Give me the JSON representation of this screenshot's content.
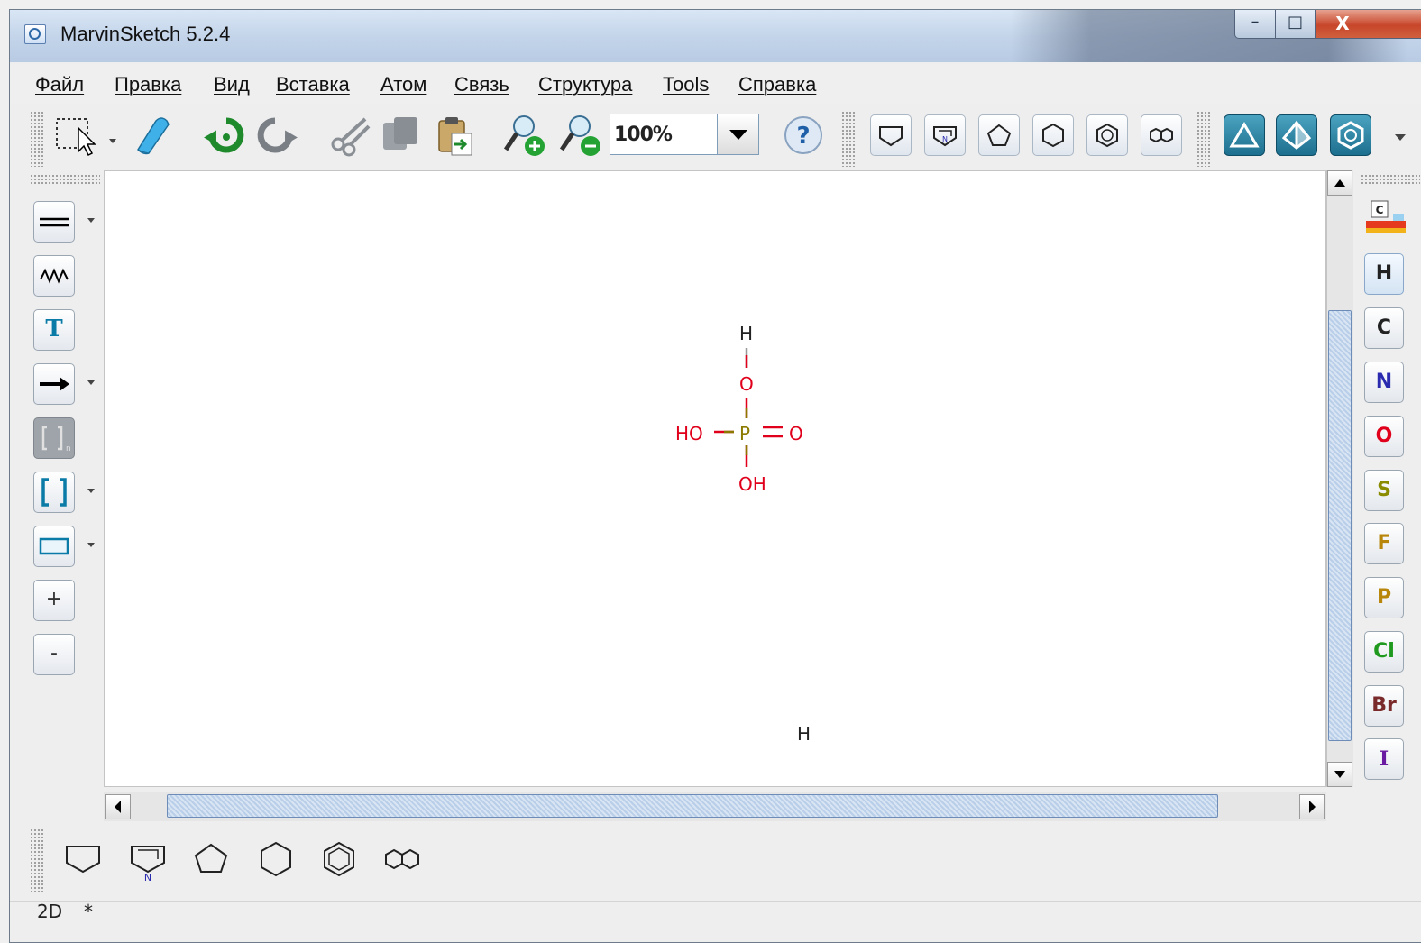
{
  "window": {
    "title": "MarvinSketch 5.2.4",
    "controls": {
      "minimize": "–",
      "maximize": "□",
      "close": "X"
    }
  },
  "menu": {
    "items": [
      "Файл",
      "Правка",
      "Вид",
      "Вставка",
      "Атом",
      "Связь",
      "Структура",
      "Tools",
      "Справка"
    ]
  },
  "toolbar": {
    "zoom_value": "100%",
    "help_label": "?",
    "icons": [
      "selection-icon",
      "eraser-icon",
      "undo-icon",
      "redo-icon",
      "cut-icon",
      "copy-icon",
      "paste-icon",
      "zoom-in-icon",
      "zoom-out-icon",
      "help-icon"
    ],
    "templates": [
      "cyclohexane-chair-template",
      "pyrrolidine-template",
      "cyclopentane-template",
      "cyclohexane-template",
      "benzene-template",
      "naphthalene-template"
    ],
    "view_modes": [
      "2d-triangle-icon",
      "3d-tetrahedron-icon",
      "aromatic-ring-icon"
    ]
  },
  "left_tools": {
    "text_tool": "T",
    "plus": "+",
    "minus": "-",
    "items": [
      "double-bond-icon",
      "chain-icon",
      "text-tool",
      "reaction-arrow-icon",
      "repeating-unit-icon",
      "bracket-icon",
      "rectangle-icon",
      "charge-plus-button",
      "charge-minus-button"
    ]
  },
  "canvas": {
    "atoms": {
      "top_h": "H",
      "top_o": "O",
      "ho": "HO",
      "p": "P",
      "eq_o": "O",
      "oh": "OH",
      "stray_h": "H"
    },
    "colors": {
      "oxygen": "#e0001b",
      "phosphorus": "#8b7a00",
      "hydrogen": "#222222"
    }
  },
  "elements": [
    {
      "symbol": "H",
      "color": "#222222"
    },
    {
      "symbol": "C",
      "color": "#222222"
    },
    {
      "symbol": "N",
      "color": "#2b2bb0"
    },
    {
      "symbol": "O",
      "color": "#e0001b"
    },
    {
      "symbol": "S",
      "color": "#8b8b00"
    },
    {
      "symbol": "F",
      "color": "#b8860b"
    },
    {
      "symbol": "P",
      "color": "#b8860b"
    },
    {
      "symbol": "Cl",
      "color": "#1f9a1f"
    },
    {
      "symbol": "Br",
      "color": "#7a2a2a"
    },
    {
      "symbol": "I",
      "color": "#6a1aa0"
    }
  ],
  "status": {
    "mode": "2D",
    "modified": "*"
  }
}
